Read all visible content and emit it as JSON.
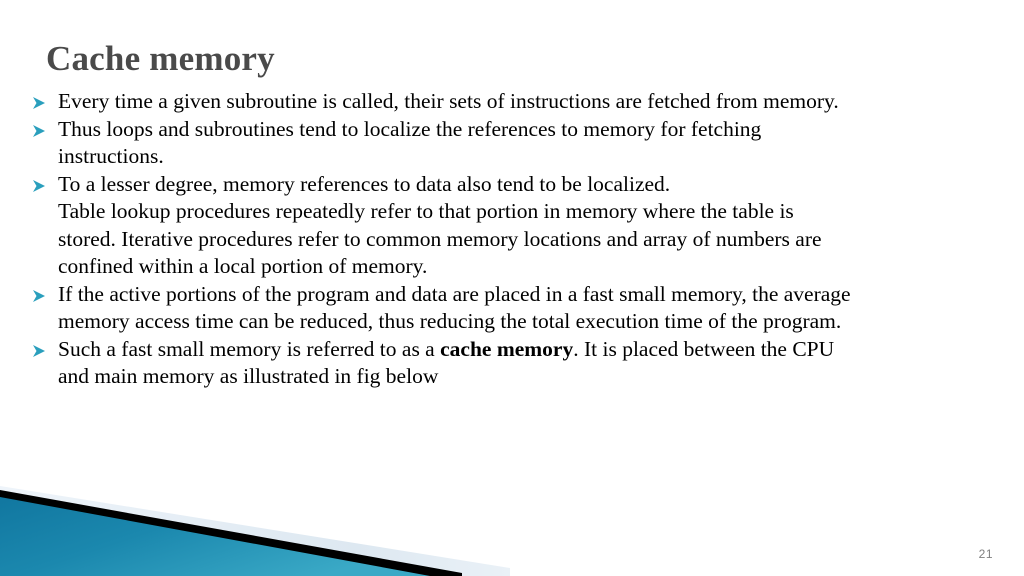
{
  "slide": {
    "title": "Cache memory",
    "title_color": "#4a4a4a",
    "background_color": "#ffffff",
    "body_text_color": "#000000",
    "slide_number": "21"
  },
  "bullets": [
    {
      "marker": "arrowhead-bullet-icon",
      "lines": [
        "Every time a given subroutine is called, their sets of instructions are fetched from memory."
      ]
    },
    {
      "marker": "arrowhead-bullet-icon",
      "lines": [
        "Thus loops and subroutines tend to localize the references to memory for fetching",
        "instructions."
      ]
    },
    {
      "marker": "arrowhead-bullet-icon",
      "lines": [
        "To a lesser degree, memory references to data also tend to be localized.",
        "Table lookup procedures repeatedly refer to that portion in memory where the table is",
        "stored. Iterative procedures refer to common memory locations and array of numbers are",
        "confined within a local portion of memory."
      ]
    },
    {
      "marker": "arrowhead-bullet-icon",
      "lines": [
        "If the active portions of the program and data are placed in a fast small memory, the average",
        "memory access time can be reduced, thus reducing the total execution time of the program."
      ]
    },
    {
      "marker": "arrowhead-bullet-icon",
      "lines_rich": [
        [
          {
            "text": "Such a fast small memory is referred to as a ",
            "bold": false
          },
          {
            "text": "cache memory",
            "bold": true
          },
          {
            "text": ". It is placed between the CPU",
            "bold": false
          }
        ],
        [
          {
            "text": "and main memory as illustrated in fig below",
            "bold": false
          }
        ]
      ]
    }
  ],
  "decoration": {
    "name": "bottom-left-diagonal-banner",
    "teal_light": "#35a8c9",
    "teal_mid": "#1b88ae",
    "teal_dark": "#1177a0",
    "black": "#000000",
    "pale_blue": "#dfe9f2",
    "bullet_color": "#2a9fbd"
  }
}
